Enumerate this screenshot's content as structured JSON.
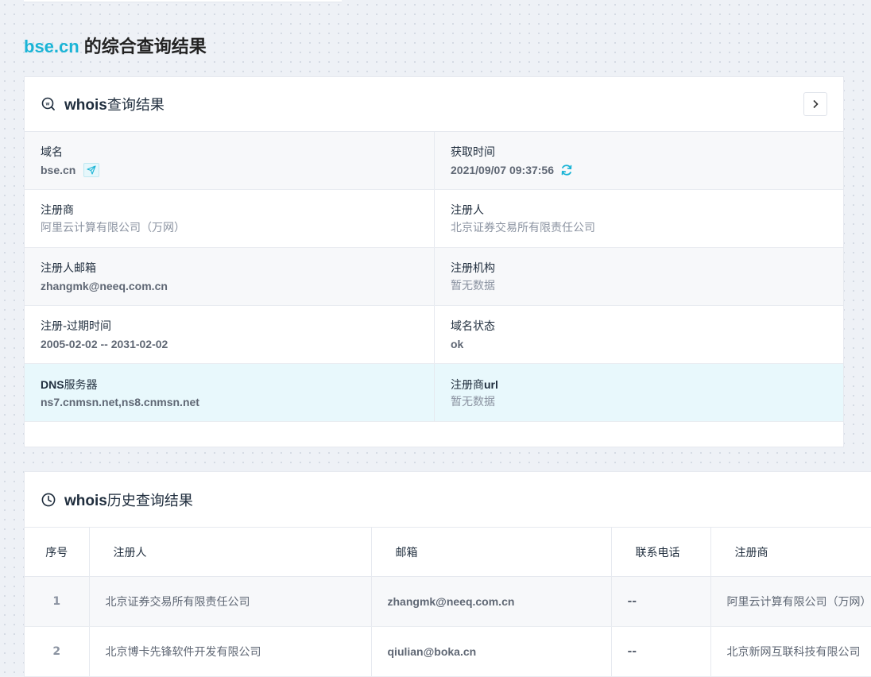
{
  "page": {
    "domain": "bse.cn",
    "title_suffix": "的综合查询结果"
  },
  "whois": {
    "title_bold": "whois",
    "title_rest": "查询结果",
    "fields": {
      "domain_label": "域名",
      "domain_value": "bse.cn",
      "fetch_time_label": "获取时间",
      "fetch_time_value": "2021/09/07 09:37:56",
      "registrar_label": "注册商",
      "registrar_value": "阿里云计算有限公司（万网）",
      "registrant_label": "注册人",
      "registrant_value": "北京证券交易所有限责任公司",
      "email_label": "注册人邮箱",
      "email_value": "zhangmk@neeq.com.cn",
      "org_label": "注册机构",
      "org_value": "暂无数据",
      "period_label": "注册-过期时间",
      "period_value": "2005-02-02 -- 2031-02-02",
      "status_label": "域名状态",
      "status_value": "ok",
      "dns_label_en": "DNS",
      "dns_label_cn": "服务器",
      "dns_value": "ns7.cnmsn.net,ns8.cnmsn.net",
      "registrar_url_label_cn": "注册商",
      "registrar_url_label_en": "url",
      "registrar_url_value": "暂无数据"
    }
  },
  "history": {
    "title_bold": "whois",
    "title_rest": "历史查询结果",
    "columns": [
      "序号",
      "注册人",
      "邮箱",
      "联系电话",
      "注册商"
    ],
    "rows": [
      {
        "no": "1",
        "registrant": "北京证券交易所有限责任公司",
        "email": "zhangmk@neeq.com.cn",
        "phone": "--",
        "registrar": "阿里云计算有限公司（万网）"
      },
      {
        "no": "2",
        "registrant": "北京博卡先锋软件开发有限公司",
        "email": "qiulian@boka.cn",
        "phone": "--",
        "registrar": "北京新网互联科技有限公司"
      }
    ]
  },
  "icons": {
    "whois": "whois-logo-icon",
    "expand": "chevron-right-icon",
    "goto": "send-arrow-icon",
    "refresh": "refresh-icon",
    "history": "clock-icon"
  },
  "colors": {
    "accent": "#1ab4d6",
    "highlight_row": "#e8f8fc"
  }
}
